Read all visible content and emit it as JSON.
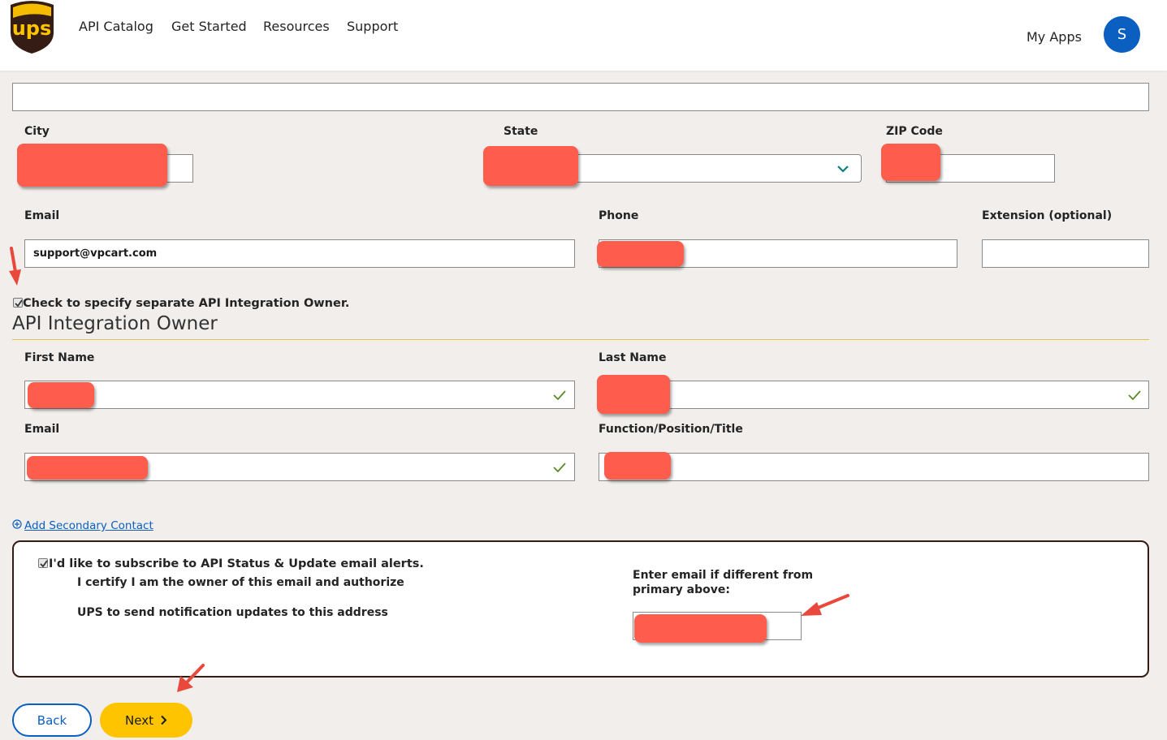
{
  "header": {
    "logo_text": "ups",
    "nav": [
      "API Catalog",
      "Get Started",
      "Resources",
      "Support"
    ],
    "my_apps": "My Apps",
    "avatar_initial": "S"
  },
  "address": {
    "city_label": "City",
    "state_label": "State",
    "zip_label": "ZIP Code"
  },
  "contact": {
    "email_label": "Email",
    "email_value": "support@vpcart.com",
    "phone_label": "Phone",
    "extension_label": "Extension (optional)"
  },
  "owner_toggle": {
    "label": "Check to specify separate API Integration Owner.",
    "checked": true
  },
  "owner": {
    "title": "API Integration Owner",
    "first_name_label": "First Name",
    "last_name_label": "Last Name",
    "email_label": "Email",
    "function_label": "Function/Position/Title"
  },
  "add_secondary": "Add Secondary Contact",
  "subscribe": {
    "label": "I'd like to subscribe to API Status & Update email alerts.",
    "certify_line1": "I certify I am the owner of this email and authorize",
    "certify_line2": "UPS to send notification updates to this address",
    "alt_email_label": "Enter email if different from primary above:",
    "checked": true
  },
  "buttons": {
    "back": "Back",
    "next": "Next"
  },
  "colors": {
    "brand_brown": "#351c15",
    "brand_gold": "#ffc400",
    "avatar_blue": "#0b5fc1",
    "link_blue": "#0b5fc1",
    "valid_green": "#5c8a2a"
  }
}
